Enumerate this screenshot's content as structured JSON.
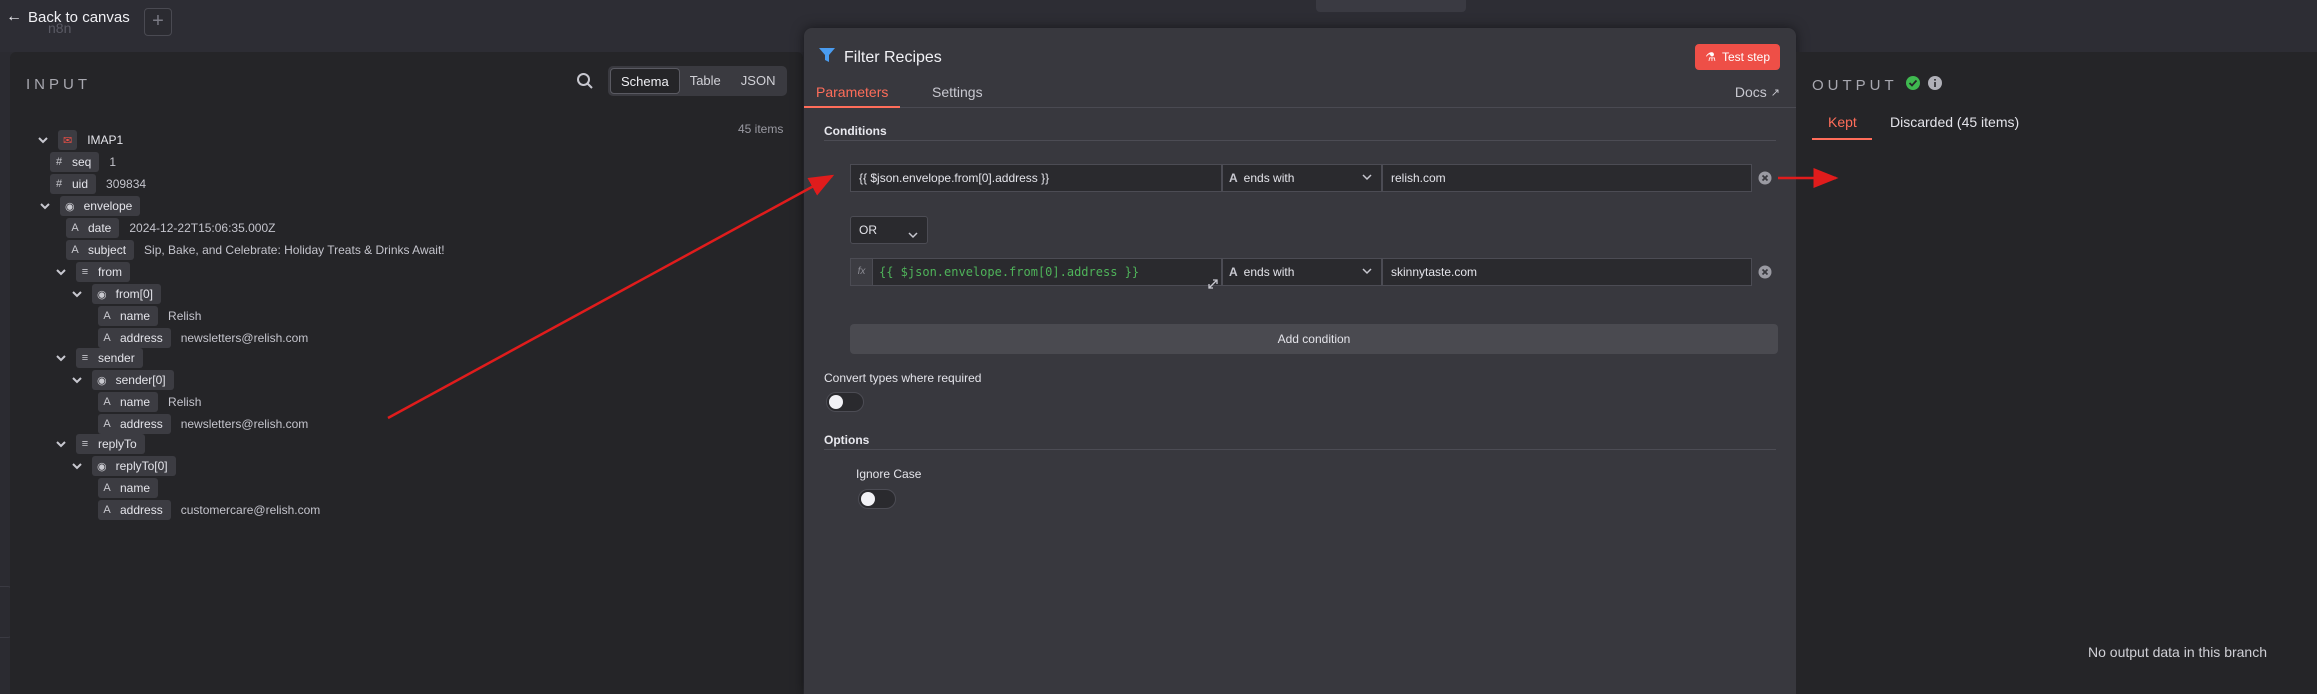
{
  "topbar": {
    "back_label": "Back to canvas",
    "ghost_logo": "n8n",
    "plus_label": "+"
  },
  "input": {
    "heading": "INPUT",
    "view_tabs": [
      "Schema",
      "Table",
      "JSON"
    ],
    "active_view": "Schema",
    "item_count": "45 items",
    "root_node": "IMAP1",
    "tree": [
      {
        "type": "#",
        "key": "seq",
        "value": "1"
      },
      {
        "type": "#",
        "key": "uid",
        "value": "309834"
      },
      {
        "type": "obj",
        "key": "envelope",
        "value": ""
      },
      {
        "type": "A",
        "key": "date",
        "value": "2024-12-22T15:06:35.000Z"
      },
      {
        "type": "A",
        "key": "subject",
        "value": "Sip, Bake, and Celebrate: Holiday Treats & Drinks Await!"
      },
      {
        "type": "list",
        "key": "from",
        "value": ""
      },
      {
        "type": "obj",
        "key": "from[0]",
        "value": ""
      },
      {
        "type": "A",
        "key": "name",
        "value": "Relish"
      },
      {
        "type": "A",
        "key": "address",
        "value": "newsletters@relish.com"
      },
      {
        "type": "list",
        "key": "sender",
        "value": ""
      },
      {
        "type": "obj",
        "key": "sender[0]",
        "value": ""
      },
      {
        "type": "A",
        "key": "name",
        "value": "Relish"
      },
      {
        "type": "A",
        "key": "address",
        "value": "newsletters@relish.com"
      },
      {
        "type": "list",
        "key": "replyTo",
        "value": ""
      },
      {
        "type": "obj",
        "key": "replyTo[0]",
        "value": ""
      },
      {
        "type": "A",
        "key": "name",
        "value": ""
      },
      {
        "type": "A",
        "key": "address",
        "value": "customercare@relish.com"
      }
    ]
  },
  "node": {
    "title": "Filter Recipes",
    "test_button": "Test step",
    "tabs": [
      "Parameters",
      "Settings"
    ],
    "active_tab": "Parameters",
    "docs_label": "Docs",
    "conditions_label": "Conditions",
    "condition1": {
      "left": "{{ $json.envelope.from[0].address }}",
      "operator": "ends with",
      "right": "relish.com"
    },
    "combinator": "OR",
    "condition2": {
      "fx": "fx",
      "left": "{{ $json.envelope.from[0].address }}",
      "operator": "ends with",
      "right": "skinnytaste.com"
    },
    "add_condition": "Add condition",
    "convert_types_label": "Convert types where required",
    "options_label": "Options",
    "ignore_case_label": "Ignore Case"
  },
  "output": {
    "heading": "OUTPUT",
    "tabs": [
      "Kept",
      "Discarded (45 items)"
    ],
    "active_tab": "Kept",
    "empty_message": "No output data in this branch"
  },
  "colors": {
    "accent": "#ff6d5a",
    "test_button": "#ee4f47",
    "success": "#3fb950",
    "expression_green": "#4fb35a",
    "filter_icon": "#4a9cf0",
    "arrow": "#e01c1c"
  }
}
